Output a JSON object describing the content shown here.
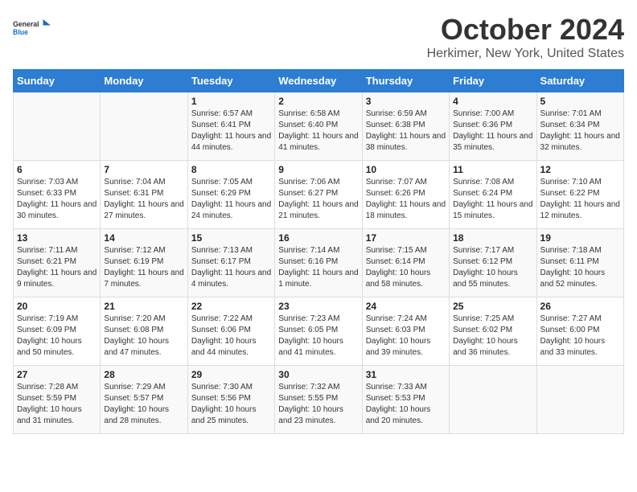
{
  "logo": {
    "general": "General",
    "blue": "Blue"
  },
  "title": "October 2024",
  "location": "Herkimer, New York, United States",
  "days_of_week": [
    "Sunday",
    "Monday",
    "Tuesday",
    "Wednesday",
    "Thursday",
    "Friday",
    "Saturday"
  ],
  "weeks": [
    [
      {
        "day": "",
        "sunrise": "",
        "sunset": "",
        "daylight": ""
      },
      {
        "day": "",
        "sunrise": "",
        "sunset": "",
        "daylight": ""
      },
      {
        "day": "1",
        "sunrise": "Sunrise: 6:57 AM",
        "sunset": "Sunset: 6:41 PM",
        "daylight": "Daylight: 11 hours and 44 minutes."
      },
      {
        "day": "2",
        "sunrise": "Sunrise: 6:58 AM",
        "sunset": "Sunset: 6:40 PM",
        "daylight": "Daylight: 11 hours and 41 minutes."
      },
      {
        "day": "3",
        "sunrise": "Sunrise: 6:59 AM",
        "sunset": "Sunset: 6:38 PM",
        "daylight": "Daylight: 11 hours and 38 minutes."
      },
      {
        "day": "4",
        "sunrise": "Sunrise: 7:00 AM",
        "sunset": "Sunset: 6:36 PM",
        "daylight": "Daylight: 11 hours and 35 minutes."
      },
      {
        "day": "5",
        "sunrise": "Sunrise: 7:01 AM",
        "sunset": "Sunset: 6:34 PM",
        "daylight": "Daylight: 11 hours and 32 minutes."
      }
    ],
    [
      {
        "day": "6",
        "sunrise": "Sunrise: 7:03 AM",
        "sunset": "Sunset: 6:33 PM",
        "daylight": "Daylight: 11 hours and 30 minutes."
      },
      {
        "day": "7",
        "sunrise": "Sunrise: 7:04 AM",
        "sunset": "Sunset: 6:31 PM",
        "daylight": "Daylight: 11 hours and 27 minutes."
      },
      {
        "day": "8",
        "sunrise": "Sunrise: 7:05 AM",
        "sunset": "Sunset: 6:29 PM",
        "daylight": "Daylight: 11 hours and 24 minutes."
      },
      {
        "day": "9",
        "sunrise": "Sunrise: 7:06 AM",
        "sunset": "Sunset: 6:27 PM",
        "daylight": "Daylight: 11 hours and 21 minutes."
      },
      {
        "day": "10",
        "sunrise": "Sunrise: 7:07 AM",
        "sunset": "Sunset: 6:26 PM",
        "daylight": "Daylight: 11 hours and 18 minutes."
      },
      {
        "day": "11",
        "sunrise": "Sunrise: 7:08 AM",
        "sunset": "Sunset: 6:24 PM",
        "daylight": "Daylight: 11 hours and 15 minutes."
      },
      {
        "day": "12",
        "sunrise": "Sunrise: 7:10 AM",
        "sunset": "Sunset: 6:22 PM",
        "daylight": "Daylight: 11 hours and 12 minutes."
      }
    ],
    [
      {
        "day": "13",
        "sunrise": "Sunrise: 7:11 AM",
        "sunset": "Sunset: 6:21 PM",
        "daylight": "Daylight: 11 hours and 9 minutes."
      },
      {
        "day": "14",
        "sunrise": "Sunrise: 7:12 AM",
        "sunset": "Sunset: 6:19 PM",
        "daylight": "Daylight: 11 hours and 7 minutes."
      },
      {
        "day": "15",
        "sunrise": "Sunrise: 7:13 AM",
        "sunset": "Sunset: 6:17 PM",
        "daylight": "Daylight: 11 hours and 4 minutes."
      },
      {
        "day": "16",
        "sunrise": "Sunrise: 7:14 AM",
        "sunset": "Sunset: 6:16 PM",
        "daylight": "Daylight: 11 hours and 1 minute."
      },
      {
        "day": "17",
        "sunrise": "Sunrise: 7:15 AM",
        "sunset": "Sunset: 6:14 PM",
        "daylight": "Daylight: 10 hours and 58 minutes."
      },
      {
        "day": "18",
        "sunrise": "Sunrise: 7:17 AM",
        "sunset": "Sunset: 6:12 PM",
        "daylight": "Daylight: 10 hours and 55 minutes."
      },
      {
        "day": "19",
        "sunrise": "Sunrise: 7:18 AM",
        "sunset": "Sunset: 6:11 PM",
        "daylight": "Daylight: 10 hours and 52 minutes."
      }
    ],
    [
      {
        "day": "20",
        "sunrise": "Sunrise: 7:19 AM",
        "sunset": "Sunset: 6:09 PM",
        "daylight": "Daylight: 10 hours and 50 minutes."
      },
      {
        "day": "21",
        "sunrise": "Sunrise: 7:20 AM",
        "sunset": "Sunset: 6:08 PM",
        "daylight": "Daylight: 10 hours and 47 minutes."
      },
      {
        "day": "22",
        "sunrise": "Sunrise: 7:22 AM",
        "sunset": "Sunset: 6:06 PM",
        "daylight": "Daylight: 10 hours and 44 minutes."
      },
      {
        "day": "23",
        "sunrise": "Sunrise: 7:23 AM",
        "sunset": "Sunset: 6:05 PM",
        "daylight": "Daylight: 10 hours and 41 minutes."
      },
      {
        "day": "24",
        "sunrise": "Sunrise: 7:24 AM",
        "sunset": "Sunset: 6:03 PM",
        "daylight": "Daylight: 10 hours and 39 minutes."
      },
      {
        "day": "25",
        "sunrise": "Sunrise: 7:25 AM",
        "sunset": "Sunset: 6:02 PM",
        "daylight": "Daylight: 10 hours and 36 minutes."
      },
      {
        "day": "26",
        "sunrise": "Sunrise: 7:27 AM",
        "sunset": "Sunset: 6:00 PM",
        "daylight": "Daylight: 10 hours and 33 minutes."
      }
    ],
    [
      {
        "day": "27",
        "sunrise": "Sunrise: 7:28 AM",
        "sunset": "Sunset: 5:59 PM",
        "daylight": "Daylight: 10 hours and 31 minutes."
      },
      {
        "day": "28",
        "sunrise": "Sunrise: 7:29 AM",
        "sunset": "Sunset: 5:57 PM",
        "daylight": "Daylight: 10 hours and 28 minutes."
      },
      {
        "day": "29",
        "sunrise": "Sunrise: 7:30 AM",
        "sunset": "Sunset: 5:56 PM",
        "daylight": "Daylight: 10 hours and 25 minutes."
      },
      {
        "day": "30",
        "sunrise": "Sunrise: 7:32 AM",
        "sunset": "Sunset: 5:55 PM",
        "daylight": "Daylight: 10 hours and 23 minutes."
      },
      {
        "day": "31",
        "sunrise": "Sunrise: 7:33 AM",
        "sunset": "Sunset: 5:53 PM",
        "daylight": "Daylight: 10 hours and 20 minutes."
      },
      {
        "day": "",
        "sunrise": "",
        "sunset": "",
        "daylight": ""
      },
      {
        "day": "",
        "sunrise": "",
        "sunset": "",
        "daylight": ""
      }
    ]
  ]
}
